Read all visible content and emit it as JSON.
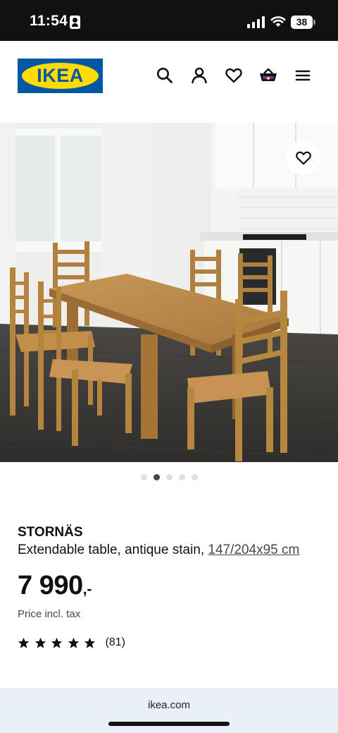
{
  "status_bar": {
    "time": "11:54",
    "battery": "38",
    "icons": [
      "contact-card-icon",
      "cellular-signal-icon",
      "wifi-icon",
      "battery-icon"
    ]
  },
  "header": {
    "logo_text": "IKEA",
    "icons": [
      "search-icon",
      "profile-icon",
      "heart-icon",
      "basket-icon",
      "menu-icon"
    ]
  },
  "hero": {
    "carousel_count": 5,
    "carousel_active_index": 1
  },
  "product": {
    "name": "STORNÄS",
    "description": "Extendable table, antique stain,",
    "measurement": "147/204x95 cm",
    "price_integer": "7 990",
    "price_suffix": ",-",
    "price_note": "Price incl. tax",
    "rating_stars": 5,
    "review_count": "(81)"
  },
  "browser": {
    "url": "ikea.com"
  },
  "colors": {
    "ikea_blue": "#0058a3",
    "ikea_yellow": "#ffdb00",
    "text": "#111111",
    "muted": "#484848"
  }
}
